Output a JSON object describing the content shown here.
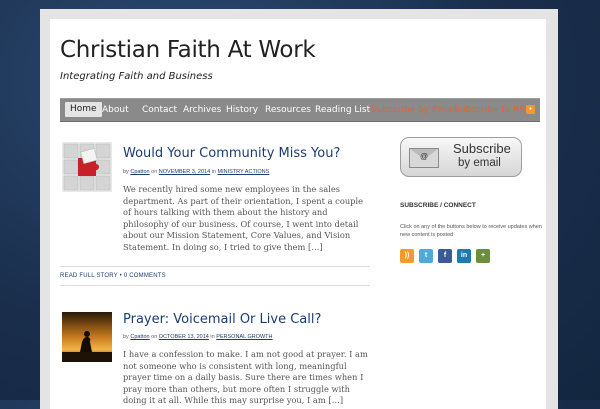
{
  "header": {
    "title": "Christian Faith At Work",
    "tagline": "Integrating Faith and Business"
  },
  "nav": {
    "items": [
      "Home",
      "About",
      "Contact",
      "Archives",
      "History",
      "Resources",
      "Reading List"
    ],
    "subscribe_email": "Subscribe by Email",
    "subscribe_rss": "Subscribe to RSS"
  },
  "posts": [
    {
      "title": "Would Your Community Miss You?",
      "meta_by": "by",
      "author": "Cpatton",
      "meta_on": "on",
      "date": "NOVEMBER 3, 2014",
      "meta_in": "in",
      "category": "MINISTRY ACTIONS",
      "excerpt": "We recently hired some new employees in the sales department. As part of their orientation, I spent a couple of hours talking with them about the history and philosophy of our business. Of course, I went into detail about our Mission Statement, Core Values, and Vision Statement. In doing so, I tried to give them […]",
      "read_more": "READ FULL STORY",
      "comments": "0 COMMENTS"
    },
    {
      "title": "Prayer: Voicemail Or Live Call?",
      "meta_by": "by",
      "author": "Cpatton",
      "meta_on": "on",
      "date": "OCTOBER 13, 2014",
      "meta_in": "in",
      "category": "PERSONAL GROWTH",
      "excerpt": "I have a confession to make. I am not good at prayer. I am not someone who is consistent with long, meaningful prayer time on a daily basis. Sure there are times when I pray more than others, but more often I struggle with doing it at all. While this may surprise you, I am […]"
    }
  ],
  "sidebar": {
    "subscribe_line1": "Subscribe",
    "subscribe_line2": "by email",
    "subscribe_icon_text": "@",
    "widget_title": "SUBSCRIBE / CONNECT",
    "widget_text": "Click on any of the buttons below to receive updates when new content is posted",
    "social": [
      {
        "icon": "rss-icon",
        "glyph": "))",
        "color": "#f39a2a"
      },
      {
        "icon": "twitter-icon",
        "glyph": "t",
        "color": "#4fa9d9"
      },
      {
        "icon": "facebook-icon",
        "glyph": "f",
        "color": "#3b5b98"
      },
      {
        "icon": "linkedin-icon",
        "glyph": "in",
        "color": "#1c7ab0"
      },
      {
        "icon": "plus-icon",
        "glyph": "+",
        "color": "#6b8e3a"
      }
    ]
  },
  "colors": {
    "link": "#1b3c73",
    "accent": "#e8632c",
    "nav_bg": "#8a8a8a"
  }
}
